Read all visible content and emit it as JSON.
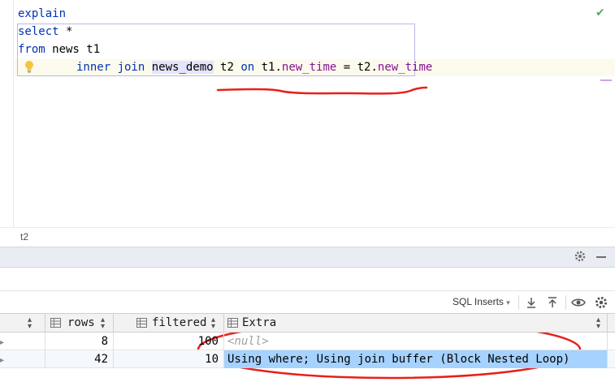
{
  "editor": {
    "lines": {
      "l1_kw": "explain",
      "l2_kw": "select",
      "l2_rest": " *",
      "l3_kw": "from",
      "l3_rest": " news t1",
      "l4_kw1": "inner join",
      "l4_tbl": "news_demo",
      "l4_alias": " t2 ",
      "l4_kw2": "on",
      "l4_t1": " t1.",
      "l4_f1": "new_time",
      "l4_eq": " = t2.",
      "l4_f2": "new_time"
    },
    "status_icon": "check-icon",
    "hint_icon": "lightbulb-icon"
  },
  "breadcrumb": {
    "text": "t2"
  },
  "toolbar": {
    "sql_inserts_label": "SQL Inserts",
    "icons": [
      "download-icon",
      "upload-icon",
      "eye-icon",
      "gear-icon"
    ]
  },
  "grid": {
    "columns": [
      {
        "label": "rows"
      },
      {
        "label": "filtered"
      },
      {
        "label": "Extra"
      }
    ],
    "rows": [
      {
        "rows": "8",
        "filtered": "100",
        "extra": "<null>"
      },
      {
        "rows": "42",
        "filtered": "10",
        "extra": "Using where; Using join buffer (Block Nested Loop)"
      }
    ]
  },
  "colors": {
    "keyword": "#0033b3",
    "field": "#871094",
    "annotation": "#e8201a",
    "selection": "#a6d2ff",
    "header_bar": "#e9edf3"
  }
}
